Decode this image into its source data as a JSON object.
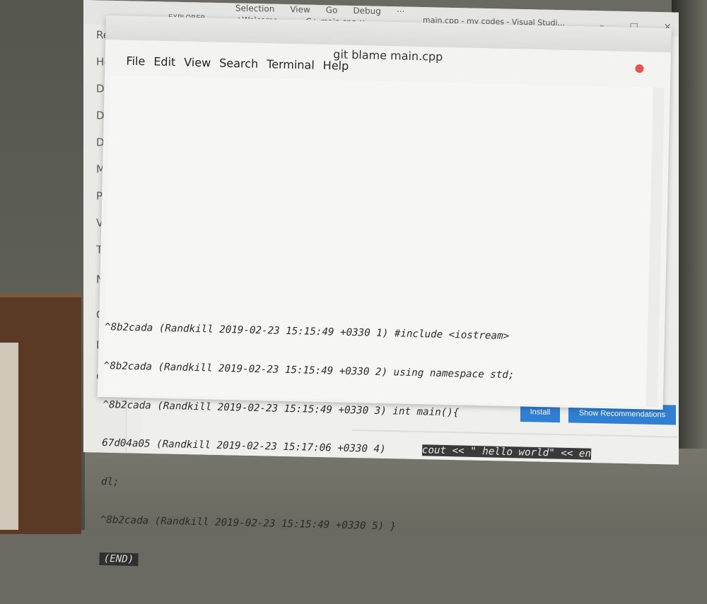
{
  "vscode": {
    "menu": [
      "Selection",
      "View",
      "Go",
      "Debug",
      "···"
    ],
    "title": "main.cpp - my codes - Visual Studi...",
    "explorer_label": "EXPLORER",
    "tabs": [
      "Welcome",
      "main.cpp"
    ],
    "sidebar_items": [
      "Re",
      "Ho",
      "De",
      "Do",
      "Do",
      "Mu",
      "Pic",
      "Vid",
      "Tra",
      "Ne",
      "Co",
      "DS",
      "Co"
    ],
    "install_label": "Install",
    "show_recommendations_label": "Show Recommendations"
  },
  "terminal": {
    "title": "git blame main.cpp",
    "menus": [
      "File",
      "Edit",
      "View",
      "Search",
      "Terminal",
      "Help"
    ],
    "lines": [
      {
        "prefix": "^8b2cada (Randkill 2019-02-23 15:15:49 +0330 1) #include <iostream>",
        "highlight": ""
      },
      {
        "prefix": "^8b2cada (Randkill 2019-02-23 15:15:49 +0330 2) using namespace std;",
        "highlight": ""
      },
      {
        "prefix": "^8b2cada (Randkill 2019-02-23 15:15:49 +0330 3) int main(){",
        "highlight": ""
      },
      {
        "prefix": "67d04a05 (Randkill 2019-02-23 15:17:06 +0330 4)      ",
        "highlight": "cout << \" hello world\" << en"
      },
      {
        "prefix": "dl;",
        "highlight": ""
      },
      {
        "prefix": "^8b2cada (Randkill 2019-02-23 15:15:49 +0330 5) }",
        "highlight": ""
      }
    ],
    "end_marker": "(END)"
  }
}
